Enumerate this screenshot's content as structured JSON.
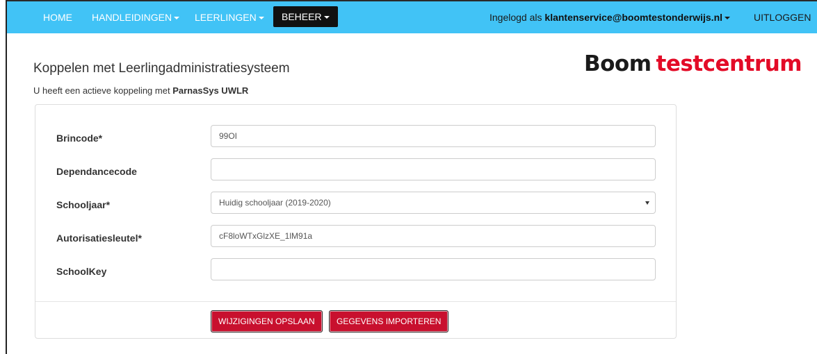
{
  "nav": {
    "home": "HOME",
    "handleidingen": "HANDLEIDINGEN",
    "leerlingen": "LEERLINGEN",
    "beheer": "BEHEER",
    "logged_in_prefix": "Ingelogd als",
    "user_email": "klantenservice@boomtestonderwijs.nl",
    "logout": "UITLOGGEN"
  },
  "logo": {
    "part1": "Boom",
    "part2": "testcentrum"
  },
  "page": {
    "title": "Koppelen met Leerlingadministratiesysteem",
    "subtitle_prefix": "U heeft een actieve koppeling met",
    "subtitle_system": "ParnasSys UWLR"
  },
  "form": {
    "brincode_label": "Brincode*",
    "brincode_value": "99OI",
    "dependancecode_label": "Dependancecode",
    "dependancecode_value": "",
    "schooljaar_label": "Schooljaar*",
    "schooljaar_selected": "Huidig schooljaar (2019-2020)",
    "autorisatiesleutel_label": "Autorisatiesleutel*",
    "autorisatiesleutel_value": "cF8loWTxGlzXE_1lM91a",
    "schoolkey_label": "SchoolKey",
    "schoolkey_value": ""
  },
  "buttons": {
    "save": "WIJZIGINGEN OPSLAAN",
    "import": "GEGEVENS IMPORTEREN"
  },
  "colors": {
    "navbar": "#41c3f6",
    "accent_red": "#c8102e",
    "logo_red": "#e30b27"
  },
  "icons": {
    "dropdown": "caret-down-icon",
    "select": "select-arrow-icon"
  }
}
